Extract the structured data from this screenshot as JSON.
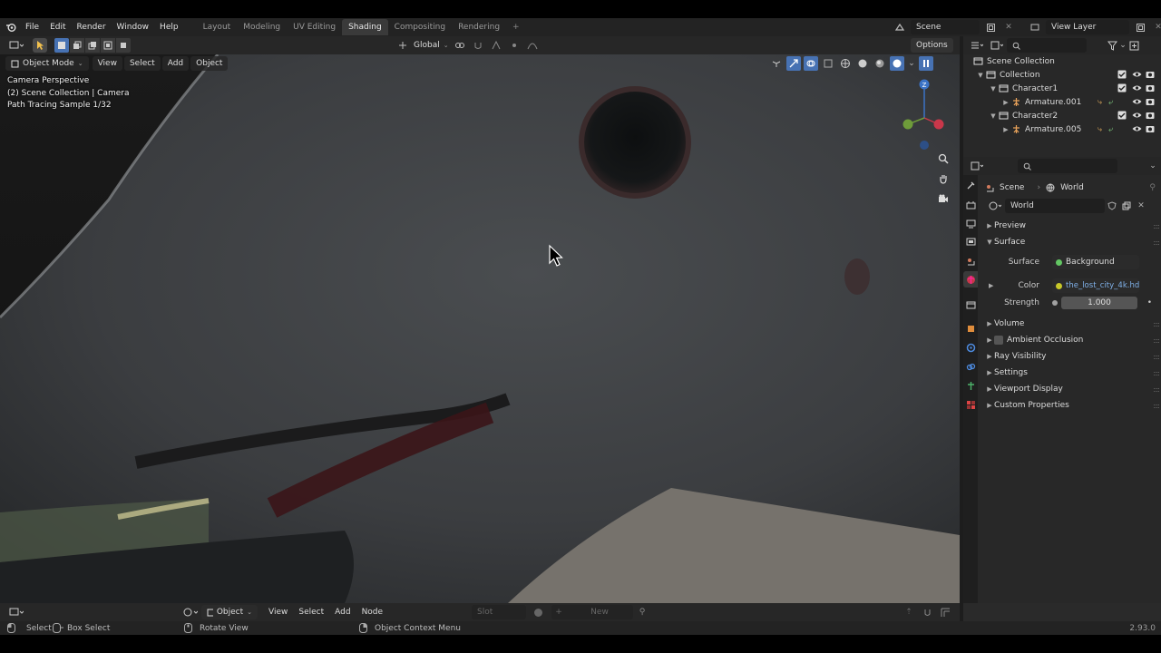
{
  "topbar": {
    "menus": [
      "File",
      "Edit",
      "Render",
      "Window",
      "Help"
    ],
    "workspace_tabs": [
      "Layout",
      "Modeling",
      "UV Editing",
      "Shading",
      "Compositing",
      "Rendering"
    ],
    "active_tab": "Shading",
    "add_tab": "+",
    "scene_name": "Scene",
    "view_layer": "View Layer"
  },
  "viewport_header": {
    "orientation": "Global",
    "options": "Options",
    "mode": "Object Mode",
    "menus": [
      "View",
      "Select",
      "Add",
      "Object"
    ]
  },
  "viewport_overlay": {
    "line1": "Camera Perspective",
    "line2": "(2) Scene Collection | Camera",
    "line3": "Path Tracing Sample 1/32"
  },
  "gizmo": {
    "z": "Z",
    "y": "",
    "x": ""
  },
  "outliner": {
    "root": "Scene Collection",
    "items": [
      {
        "label": "Collection",
        "depth": 1,
        "icon": "collection-icon"
      },
      {
        "label": "Character1",
        "depth": 2,
        "icon": "collection-icon"
      },
      {
        "label": "Armature.001",
        "depth": 3,
        "icon": "armature-icon"
      },
      {
        "label": "Character2",
        "depth": 2,
        "icon": "collection-icon"
      },
      {
        "label": "Armature.005",
        "depth": 3,
        "icon": "armature-icon"
      }
    ]
  },
  "properties": {
    "breadcrumb_scene": "Scene",
    "breadcrumb_world": "World",
    "world_name": "World",
    "panels": {
      "preview": "Preview",
      "surface": "Surface",
      "volume": "Volume",
      "ambient_occlusion": "Ambient Occlusion",
      "ray_visibility": "Ray Visibility",
      "settings": "Settings",
      "viewport_display": "Viewport Display",
      "custom_properties": "Custom Properties"
    },
    "surface_label": "Surface",
    "surface_value": "Background",
    "color_label": "Color",
    "color_value": "the_lost_city_4k.hdr",
    "strength_label": "Strength",
    "strength_value": "1.000"
  },
  "node_header": {
    "object": "Object",
    "menus": [
      "View",
      "Select",
      "Add",
      "Node"
    ],
    "slot": "Slot",
    "new": "New"
  },
  "statusbar": {
    "select": "Select",
    "box_select": "Box Select",
    "rotate_view": "Rotate View",
    "context_menu": "Object Context Menu",
    "version": "2.93.0"
  },
  "colors": {
    "accent": "#4772b3",
    "active_tab_bg": "#3a3a3a",
    "panel_bg": "#282828",
    "socket_green": "#63c763",
    "socket_yellow": "#c7c729"
  }
}
